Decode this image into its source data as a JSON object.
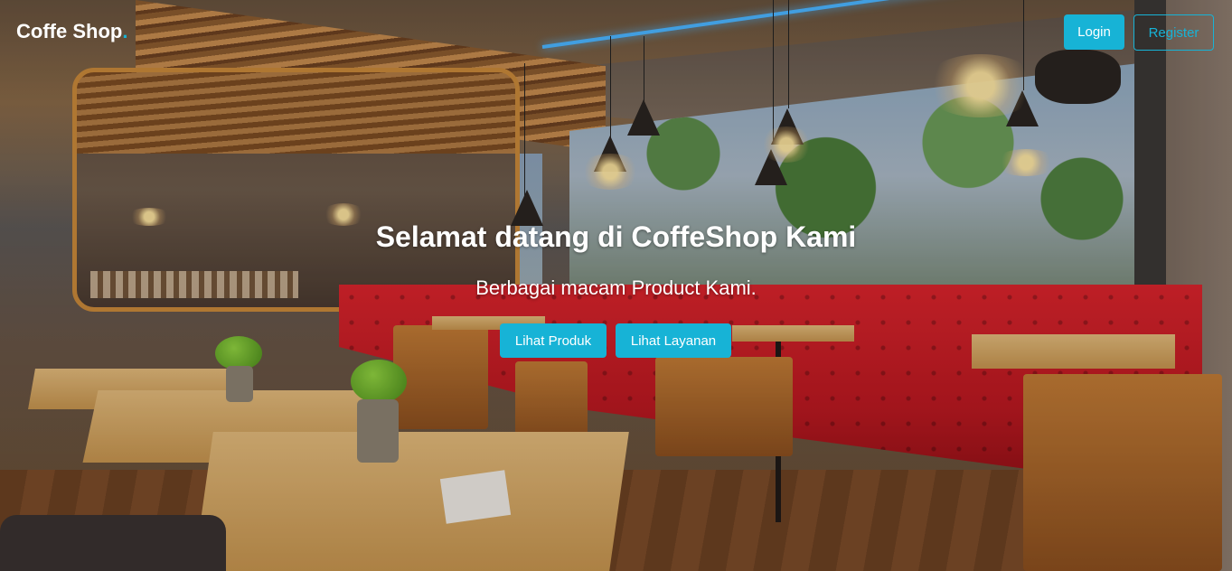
{
  "navbar": {
    "brand": "Coffe Shop",
    "brand_dot": ".",
    "login_label": "Login",
    "register_label": "Register"
  },
  "hero": {
    "title": "Selamat datang di CoffeShop Kami",
    "subtitle": "Berbagai macam Product Kami.",
    "primary_button": "Lihat Produk",
    "secondary_button": "Lihat Layanan"
  },
  "colors": {
    "accent": "#17b3d6",
    "text": "#ffffff"
  }
}
